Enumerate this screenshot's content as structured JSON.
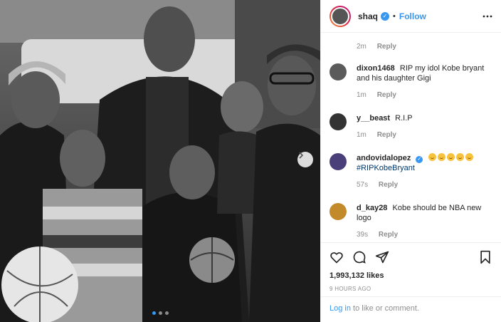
{
  "post": {
    "username": "shaq",
    "follow_label": "Follow",
    "separator": "•",
    "verified_mark": "✓"
  },
  "comments": {
    "first_meta": {
      "time": "2m",
      "reply": "Reply"
    },
    "items": [
      {
        "user": "dixon1468",
        "text": "RIP my idol Kobe bryant and his daughter Gigi",
        "time": "1m",
        "reply": "Reply"
      },
      {
        "user": "y__beast",
        "text": "R.I.P",
        "time": "1m",
        "reply": "Reply"
      },
      {
        "user": "andovidalopez",
        "hashtag": "#RIPKobeBryant",
        "emoji_count": 5,
        "time": "57s",
        "reply": "Reply"
      },
      {
        "user": "d_kay28",
        "text": "Kobe should be NBA new logo",
        "time": "39s",
        "reply": "Reply"
      }
    ]
  },
  "footer": {
    "likes": "1,993,132 likes",
    "time": "9 HOURS AGO",
    "login_link": "Log in",
    "login_suffix": " to like or comment."
  },
  "carousel": {
    "current_index": 1,
    "total": 3
  },
  "icons": {
    "like": "heart-icon",
    "comment": "comment-icon",
    "share": "share-icon",
    "save": "bookmark-icon",
    "more": "more-icon",
    "next": "chevron-right-icon"
  },
  "colors": {
    "accent": "#3897f0",
    "muted": "#8e8e8e",
    "text": "#262626",
    "border": "#efefef"
  }
}
